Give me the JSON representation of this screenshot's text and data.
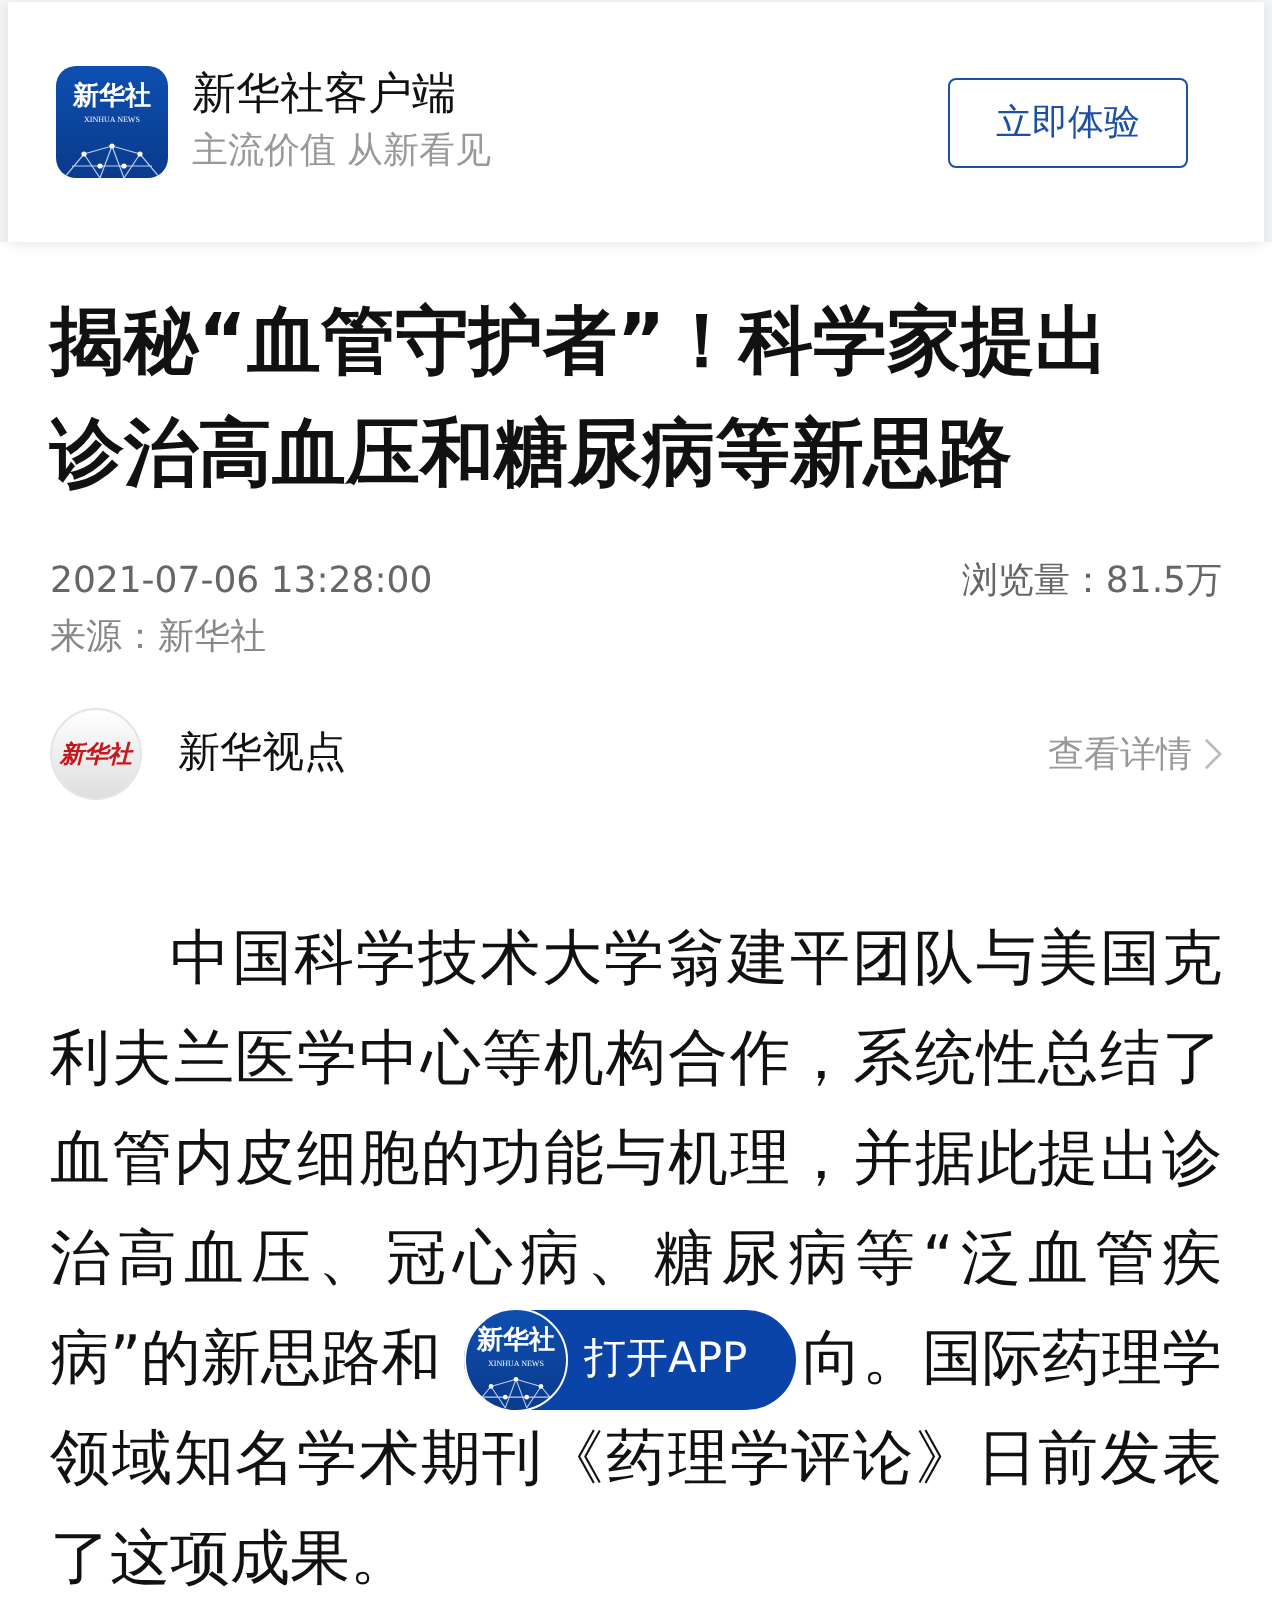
{
  "app_banner": {
    "logo_text": "新华社",
    "logo_subtext": "XINHUA NEWS",
    "name": "新华社客户端",
    "slogan": "主流价值 从新看见",
    "button": "立即体验"
  },
  "article": {
    "headline": "揭秘“血管守护者”！科学家提出诊治高血压和糖尿病等新思路",
    "datetime": "2021-07-06 13:28:00",
    "views": "浏览量：81.5万",
    "source": "来源：新华社",
    "author": {
      "avatar_text": "新华社",
      "name": "新华视点",
      "link": "查看详情"
    },
    "body": [
      {
        "kind": "full",
        "text": "中国科学技术大学翁建平团队与美国克"
      },
      {
        "kind": "full",
        "text": "利夫兰医学中心等机构合作，系统性总结了"
      },
      {
        "kind": "full",
        "text": "血管内皮细胞的功能与机理，并据此提出诊"
      },
      {
        "kind": "full",
        "text": "治高血压、冠心病、糖尿病等“泛血管疾"
      },
      {
        "kind": "split",
        "text": "病”的新思路和",
        "after": "向。国际药理学"
      },
      {
        "kind": "full",
        "text": "领域知名学术期刊《药理学评论》日前发表"
      },
      {
        "kind": "last",
        "text": "了这项成果。"
      }
    ]
  },
  "open_app": {
    "logo_text": "新华社",
    "logo_subtext": "XINHUA NEWS",
    "label": "打开APP"
  }
}
